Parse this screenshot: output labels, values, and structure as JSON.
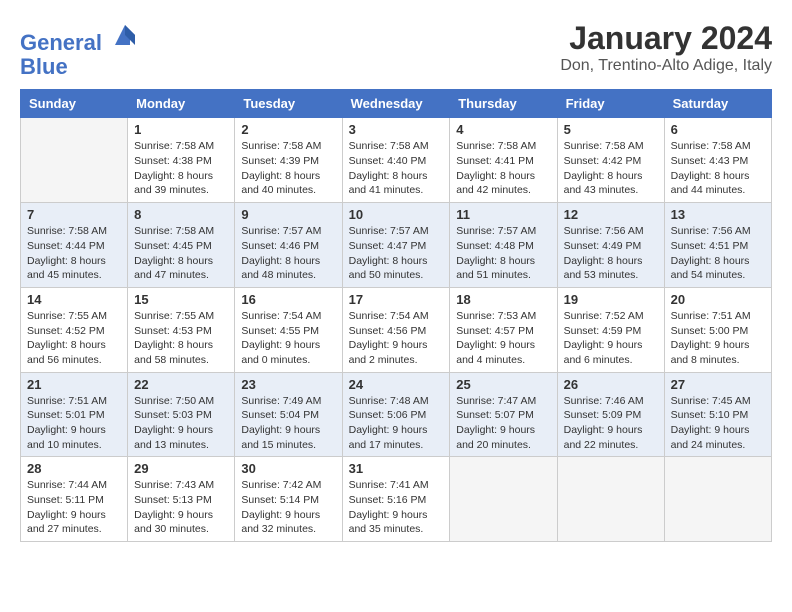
{
  "header": {
    "logo_line1": "General",
    "logo_line2": "Blue",
    "title": "January 2024",
    "location": "Don, Trentino-Alto Adige, Italy"
  },
  "days_of_week": [
    "Sunday",
    "Monday",
    "Tuesday",
    "Wednesday",
    "Thursday",
    "Friday",
    "Saturday"
  ],
  "weeks": [
    [
      {
        "day": "",
        "info": ""
      },
      {
        "day": "1",
        "info": "Sunrise: 7:58 AM\nSunset: 4:38 PM\nDaylight: 8 hours\nand 39 minutes."
      },
      {
        "day": "2",
        "info": "Sunrise: 7:58 AM\nSunset: 4:39 PM\nDaylight: 8 hours\nand 40 minutes."
      },
      {
        "day": "3",
        "info": "Sunrise: 7:58 AM\nSunset: 4:40 PM\nDaylight: 8 hours\nand 41 minutes."
      },
      {
        "day": "4",
        "info": "Sunrise: 7:58 AM\nSunset: 4:41 PM\nDaylight: 8 hours\nand 42 minutes."
      },
      {
        "day": "5",
        "info": "Sunrise: 7:58 AM\nSunset: 4:42 PM\nDaylight: 8 hours\nand 43 minutes."
      },
      {
        "day": "6",
        "info": "Sunrise: 7:58 AM\nSunset: 4:43 PM\nDaylight: 8 hours\nand 44 minutes."
      }
    ],
    [
      {
        "day": "7",
        "info": "Sunrise: 7:58 AM\nSunset: 4:44 PM\nDaylight: 8 hours\nand 45 minutes."
      },
      {
        "day": "8",
        "info": "Sunrise: 7:58 AM\nSunset: 4:45 PM\nDaylight: 8 hours\nand 47 minutes."
      },
      {
        "day": "9",
        "info": "Sunrise: 7:57 AM\nSunset: 4:46 PM\nDaylight: 8 hours\nand 48 minutes."
      },
      {
        "day": "10",
        "info": "Sunrise: 7:57 AM\nSunset: 4:47 PM\nDaylight: 8 hours\nand 50 minutes."
      },
      {
        "day": "11",
        "info": "Sunrise: 7:57 AM\nSunset: 4:48 PM\nDaylight: 8 hours\nand 51 minutes."
      },
      {
        "day": "12",
        "info": "Sunrise: 7:56 AM\nSunset: 4:49 PM\nDaylight: 8 hours\nand 53 minutes."
      },
      {
        "day": "13",
        "info": "Sunrise: 7:56 AM\nSunset: 4:51 PM\nDaylight: 8 hours\nand 54 minutes."
      }
    ],
    [
      {
        "day": "14",
        "info": "Sunrise: 7:55 AM\nSunset: 4:52 PM\nDaylight: 8 hours\nand 56 minutes."
      },
      {
        "day": "15",
        "info": "Sunrise: 7:55 AM\nSunset: 4:53 PM\nDaylight: 8 hours\nand 58 minutes."
      },
      {
        "day": "16",
        "info": "Sunrise: 7:54 AM\nSunset: 4:55 PM\nDaylight: 9 hours\nand 0 minutes."
      },
      {
        "day": "17",
        "info": "Sunrise: 7:54 AM\nSunset: 4:56 PM\nDaylight: 9 hours\nand 2 minutes."
      },
      {
        "day": "18",
        "info": "Sunrise: 7:53 AM\nSunset: 4:57 PM\nDaylight: 9 hours\nand 4 minutes."
      },
      {
        "day": "19",
        "info": "Sunrise: 7:52 AM\nSunset: 4:59 PM\nDaylight: 9 hours\nand 6 minutes."
      },
      {
        "day": "20",
        "info": "Sunrise: 7:51 AM\nSunset: 5:00 PM\nDaylight: 9 hours\nand 8 minutes."
      }
    ],
    [
      {
        "day": "21",
        "info": "Sunrise: 7:51 AM\nSunset: 5:01 PM\nDaylight: 9 hours\nand 10 minutes."
      },
      {
        "day": "22",
        "info": "Sunrise: 7:50 AM\nSunset: 5:03 PM\nDaylight: 9 hours\nand 13 minutes."
      },
      {
        "day": "23",
        "info": "Sunrise: 7:49 AM\nSunset: 5:04 PM\nDaylight: 9 hours\nand 15 minutes."
      },
      {
        "day": "24",
        "info": "Sunrise: 7:48 AM\nSunset: 5:06 PM\nDaylight: 9 hours\nand 17 minutes."
      },
      {
        "day": "25",
        "info": "Sunrise: 7:47 AM\nSunset: 5:07 PM\nDaylight: 9 hours\nand 20 minutes."
      },
      {
        "day": "26",
        "info": "Sunrise: 7:46 AM\nSunset: 5:09 PM\nDaylight: 9 hours\nand 22 minutes."
      },
      {
        "day": "27",
        "info": "Sunrise: 7:45 AM\nSunset: 5:10 PM\nDaylight: 9 hours\nand 24 minutes."
      }
    ],
    [
      {
        "day": "28",
        "info": "Sunrise: 7:44 AM\nSunset: 5:11 PM\nDaylight: 9 hours\nand 27 minutes."
      },
      {
        "day": "29",
        "info": "Sunrise: 7:43 AM\nSunset: 5:13 PM\nDaylight: 9 hours\nand 30 minutes."
      },
      {
        "day": "30",
        "info": "Sunrise: 7:42 AM\nSunset: 5:14 PM\nDaylight: 9 hours\nand 32 minutes."
      },
      {
        "day": "31",
        "info": "Sunrise: 7:41 AM\nSunset: 5:16 PM\nDaylight: 9 hours\nand 35 minutes."
      },
      {
        "day": "",
        "info": ""
      },
      {
        "day": "",
        "info": ""
      },
      {
        "day": "",
        "info": ""
      }
    ]
  ]
}
